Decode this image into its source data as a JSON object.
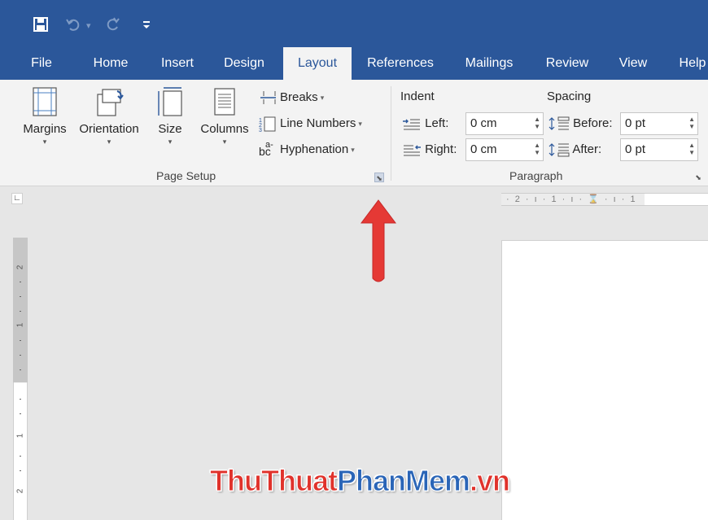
{
  "quick_access": {
    "save_icon": "save-icon",
    "undo_icon": "undo-icon",
    "undo_dropdown": "▾",
    "redo_icon": "redo-icon",
    "customize_icon": "customize-icon"
  },
  "tabs": [
    {
      "label": "File"
    },
    {
      "label": "Home"
    },
    {
      "label": "Insert"
    },
    {
      "label": "Design"
    },
    {
      "label": "Layout"
    },
    {
      "label": "References"
    },
    {
      "label": "Mailings"
    },
    {
      "label": "Review"
    },
    {
      "label": "View"
    },
    {
      "label": "Help"
    }
  ],
  "active_tab": "Layout",
  "page_setup": {
    "label": "Page Setup",
    "margins": "Margins",
    "orientation": "Orientation",
    "size": "Size",
    "columns": "Columns",
    "breaks": "Breaks",
    "line_numbers": "Line Numbers",
    "hyphenation": "Hyphenation",
    "hyphenation_icon_text": "bc",
    "hyphenation_icon_sup": "a-"
  },
  "paragraph": {
    "label": "Paragraph",
    "indent_label": "Indent",
    "spacing_label": "Spacing",
    "left_label": "Left:",
    "right_label": "Right:",
    "before_label": "Before:",
    "after_label": "After:",
    "left_value": "0 cm",
    "right_value": "0 cm",
    "before_value": "0 pt",
    "after_value": "0 pt"
  },
  "ruler": {
    "corner": "∟",
    "h_text": "· 2 · ı · 1 · ı · ⌛ · ı · 1",
    "v_numbers": [
      "2",
      "1",
      "1",
      "2"
    ]
  },
  "watermark": {
    "part_a": "ThuThuat",
    "part_b": "PhanMem",
    "part_c": ".vn"
  },
  "colors": {
    "brand": "#2b579a",
    "arrow": "#e53935"
  }
}
